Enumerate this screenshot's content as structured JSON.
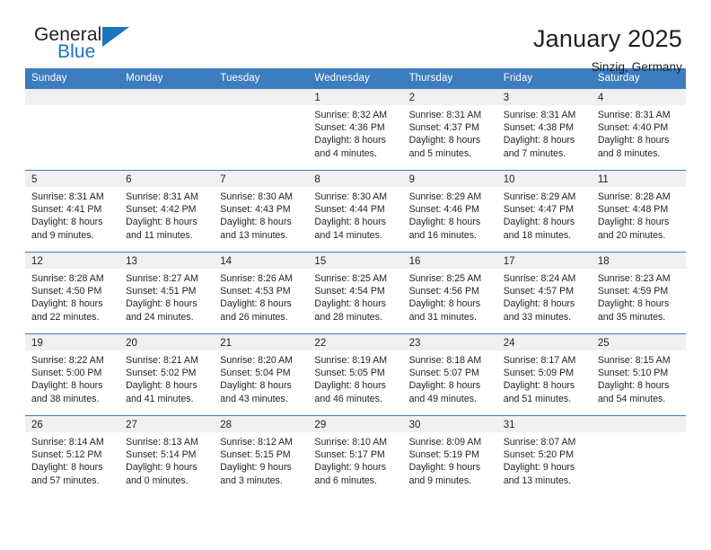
{
  "brand": {
    "name_top": "General",
    "name_bottom": "Blue",
    "color_dark": "#231f20",
    "color_blue": "#1b75bb"
  },
  "header": {
    "title": "January 2025",
    "subtitle": "Sinzig, Germany"
  },
  "theme": {
    "header_row_bg": "#3c7cbf",
    "daynum_bg": "#f0f0f0",
    "grid_line": "#3c7cbf",
    "text": "#231f20"
  },
  "labels": {
    "sunrise_prefix": "Sunrise:",
    "sunset_prefix": "Sunset:",
    "daylight_prefix": "Daylight:"
  },
  "weekdays": [
    "Sunday",
    "Monday",
    "Tuesday",
    "Wednesday",
    "Thursday",
    "Friday",
    "Saturday"
  ],
  "weeks": [
    [
      {
        "day": "",
        "blank": true,
        "sunrise": "",
        "sunset": "",
        "daylight": ""
      },
      {
        "day": "",
        "blank": true,
        "sunrise": "",
        "sunset": "",
        "daylight": ""
      },
      {
        "day": "",
        "blank": true,
        "sunrise": "",
        "sunset": "",
        "daylight": ""
      },
      {
        "day": "1",
        "sunrise": "Sunrise: 8:32 AM",
        "sunset": "Sunset: 4:36 PM",
        "daylight": "Daylight: 8 hours and 4 minutes."
      },
      {
        "day": "2",
        "sunrise": "Sunrise: 8:31 AM",
        "sunset": "Sunset: 4:37 PM",
        "daylight": "Daylight: 8 hours and 5 minutes."
      },
      {
        "day": "3",
        "sunrise": "Sunrise: 8:31 AM",
        "sunset": "Sunset: 4:38 PM",
        "daylight": "Daylight: 8 hours and 7 minutes."
      },
      {
        "day": "4",
        "sunrise": "Sunrise: 8:31 AM",
        "sunset": "Sunset: 4:40 PM",
        "daylight": "Daylight: 8 hours and 8 minutes."
      }
    ],
    [
      {
        "day": "5",
        "sunrise": "Sunrise: 8:31 AM",
        "sunset": "Sunset: 4:41 PM",
        "daylight": "Daylight: 8 hours and 9 minutes."
      },
      {
        "day": "6",
        "sunrise": "Sunrise: 8:31 AM",
        "sunset": "Sunset: 4:42 PM",
        "daylight": "Daylight: 8 hours and 11 minutes."
      },
      {
        "day": "7",
        "sunrise": "Sunrise: 8:30 AM",
        "sunset": "Sunset: 4:43 PM",
        "daylight": "Daylight: 8 hours and 13 minutes."
      },
      {
        "day": "8",
        "sunrise": "Sunrise: 8:30 AM",
        "sunset": "Sunset: 4:44 PM",
        "daylight": "Daylight: 8 hours and 14 minutes."
      },
      {
        "day": "9",
        "sunrise": "Sunrise: 8:29 AM",
        "sunset": "Sunset: 4:46 PM",
        "daylight": "Daylight: 8 hours and 16 minutes."
      },
      {
        "day": "10",
        "sunrise": "Sunrise: 8:29 AM",
        "sunset": "Sunset: 4:47 PM",
        "daylight": "Daylight: 8 hours and 18 minutes."
      },
      {
        "day": "11",
        "sunrise": "Sunrise: 8:28 AM",
        "sunset": "Sunset: 4:48 PM",
        "daylight": "Daylight: 8 hours and 20 minutes."
      }
    ],
    [
      {
        "day": "12",
        "sunrise": "Sunrise: 8:28 AM",
        "sunset": "Sunset: 4:50 PM",
        "daylight": "Daylight: 8 hours and 22 minutes."
      },
      {
        "day": "13",
        "sunrise": "Sunrise: 8:27 AM",
        "sunset": "Sunset: 4:51 PM",
        "daylight": "Daylight: 8 hours and 24 minutes."
      },
      {
        "day": "14",
        "sunrise": "Sunrise: 8:26 AM",
        "sunset": "Sunset: 4:53 PM",
        "daylight": "Daylight: 8 hours and 26 minutes."
      },
      {
        "day": "15",
        "sunrise": "Sunrise: 8:25 AM",
        "sunset": "Sunset: 4:54 PM",
        "daylight": "Daylight: 8 hours and 28 minutes."
      },
      {
        "day": "16",
        "sunrise": "Sunrise: 8:25 AM",
        "sunset": "Sunset: 4:56 PM",
        "daylight": "Daylight: 8 hours and 31 minutes."
      },
      {
        "day": "17",
        "sunrise": "Sunrise: 8:24 AM",
        "sunset": "Sunset: 4:57 PM",
        "daylight": "Daylight: 8 hours and 33 minutes."
      },
      {
        "day": "18",
        "sunrise": "Sunrise: 8:23 AM",
        "sunset": "Sunset: 4:59 PM",
        "daylight": "Daylight: 8 hours and 35 minutes."
      }
    ],
    [
      {
        "day": "19",
        "sunrise": "Sunrise: 8:22 AM",
        "sunset": "Sunset: 5:00 PM",
        "daylight": "Daylight: 8 hours and 38 minutes."
      },
      {
        "day": "20",
        "sunrise": "Sunrise: 8:21 AM",
        "sunset": "Sunset: 5:02 PM",
        "daylight": "Daylight: 8 hours and 41 minutes."
      },
      {
        "day": "21",
        "sunrise": "Sunrise: 8:20 AM",
        "sunset": "Sunset: 5:04 PM",
        "daylight": "Daylight: 8 hours and 43 minutes."
      },
      {
        "day": "22",
        "sunrise": "Sunrise: 8:19 AM",
        "sunset": "Sunset: 5:05 PM",
        "daylight": "Daylight: 8 hours and 46 minutes."
      },
      {
        "day": "23",
        "sunrise": "Sunrise: 8:18 AM",
        "sunset": "Sunset: 5:07 PM",
        "daylight": "Daylight: 8 hours and 49 minutes."
      },
      {
        "day": "24",
        "sunrise": "Sunrise: 8:17 AM",
        "sunset": "Sunset: 5:09 PM",
        "daylight": "Daylight: 8 hours and 51 minutes."
      },
      {
        "day": "25",
        "sunrise": "Sunrise: 8:15 AM",
        "sunset": "Sunset: 5:10 PM",
        "daylight": "Daylight: 8 hours and 54 minutes."
      }
    ],
    [
      {
        "day": "26",
        "sunrise": "Sunrise: 8:14 AM",
        "sunset": "Sunset: 5:12 PM",
        "daylight": "Daylight: 8 hours and 57 minutes."
      },
      {
        "day": "27",
        "sunrise": "Sunrise: 8:13 AM",
        "sunset": "Sunset: 5:14 PM",
        "daylight": "Daylight: 9 hours and 0 minutes."
      },
      {
        "day": "28",
        "sunrise": "Sunrise: 8:12 AM",
        "sunset": "Sunset: 5:15 PM",
        "daylight": "Daylight: 9 hours and 3 minutes."
      },
      {
        "day": "29",
        "sunrise": "Sunrise: 8:10 AM",
        "sunset": "Sunset: 5:17 PM",
        "daylight": "Daylight: 9 hours and 6 minutes."
      },
      {
        "day": "30",
        "sunrise": "Sunrise: 8:09 AM",
        "sunset": "Sunset: 5:19 PM",
        "daylight": "Daylight: 9 hours and 9 minutes."
      },
      {
        "day": "31",
        "sunrise": "Sunrise: 8:07 AM",
        "sunset": "Sunset: 5:20 PM",
        "daylight": "Daylight: 9 hours and 13 minutes."
      },
      {
        "day": "",
        "blank": true,
        "sunrise": "",
        "sunset": "",
        "daylight": ""
      }
    ]
  ]
}
